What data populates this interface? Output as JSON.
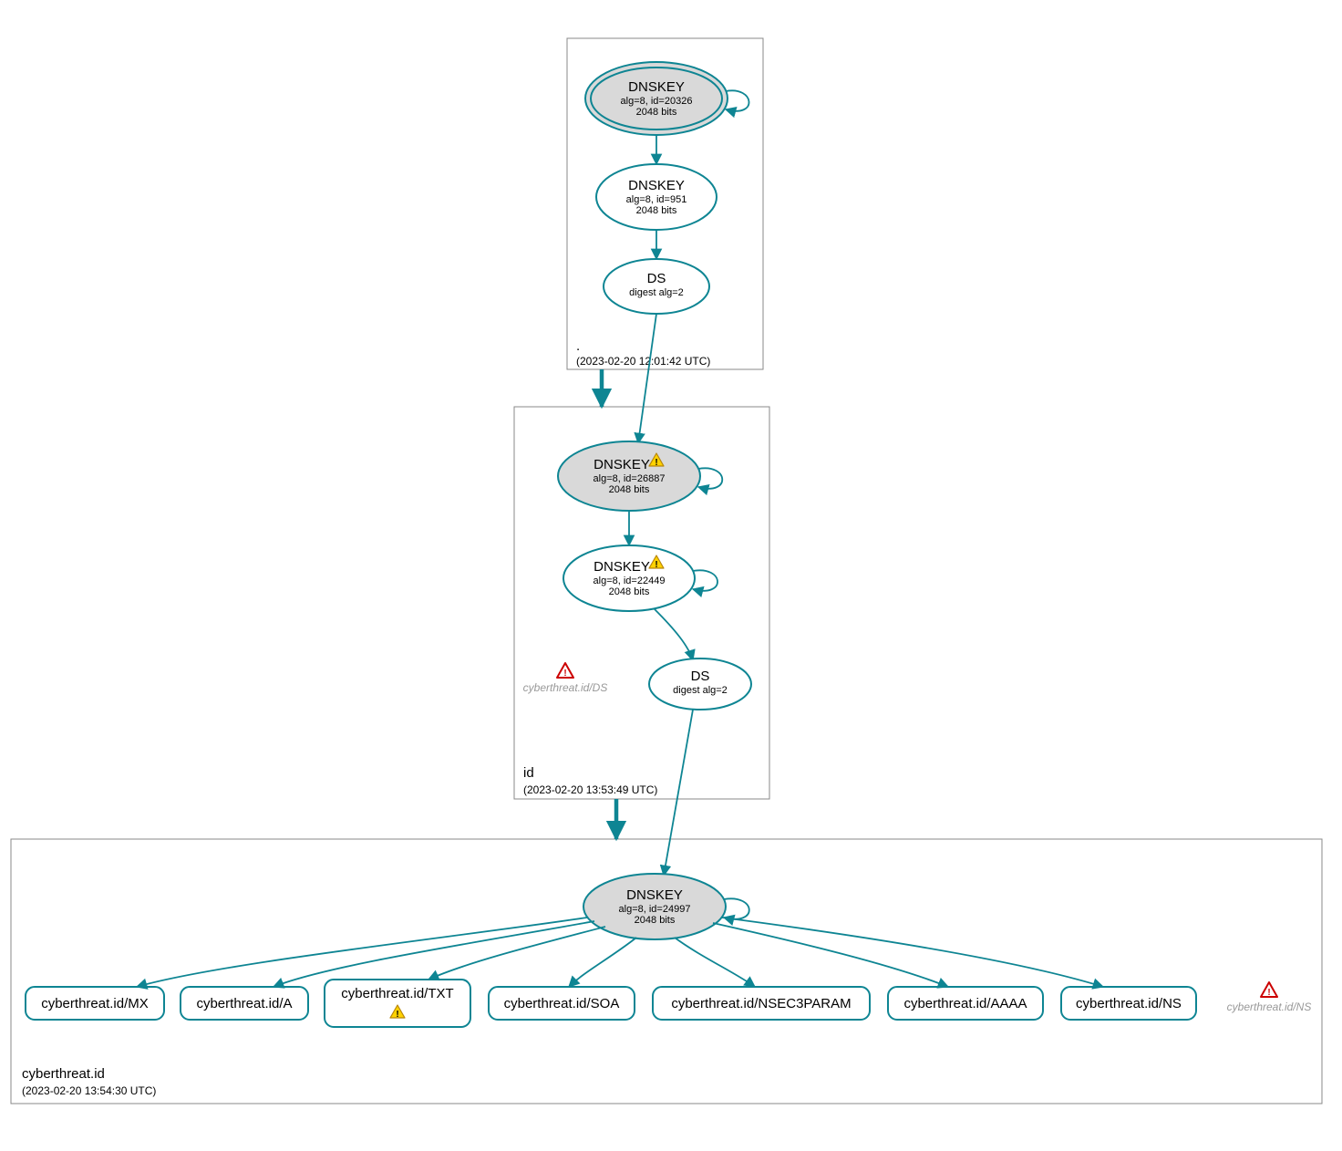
{
  "zones": {
    "root": {
      "name": ".",
      "timestamp": "(2023-02-20 12:01:42 UTC)"
    },
    "tld": {
      "name": "id",
      "timestamp": "(2023-02-20 13:53:49 UTC)"
    },
    "domain": {
      "name": "cyberthreat.id",
      "timestamp": "(2023-02-20 13:54:30 UTC)"
    }
  },
  "nodes": {
    "root_ksk": {
      "title": "DNSKEY",
      "line1": "alg=8, id=20326",
      "line2": "2048 bits"
    },
    "root_zsk": {
      "title": "DNSKEY",
      "line1": "alg=8, id=951",
      "line2": "2048 bits"
    },
    "root_ds": {
      "title": "DS",
      "line1": "digest alg=2",
      "line2": ""
    },
    "tld_ksk": {
      "title": "DNSKEY",
      "line1": "alg=8, id=26887",
      "line2": "2048 bits"
    },
    "tld_zsk": {
      "title": "DNSKEY",
      "line1": "alg=8, id=22449",
      "line2": "2048 bits"
    },
    "tld_ds": {
      "title": "DS",
      "line1": "digest alg=2",
      "line2": ""
    },
    "dom_ksk": {
      "title": "DNSKEY",
      "line1": "alg=8, id=24997",
      "line2": "2048 bits"
    }
  },
  "missing": {
    "tld_ds": "cyberthreat.id/DS",
    "dom_ns": "cyberthreat.id/NS"
  },
  "rrsets": {
    "mx": "cyberthreat.id/MX",
    "a": "cyberthreat.id/A",
    "txt": "cyberthreat.id/TXT",
    "soa": "cyberthreat.id/SOA",
    "nsec3": "cyberthreat.id/NSEC3PARAM",
    "aaaa": "cyberthreat.id/AAAA",
    "ns": "cyberthreat.id/NS"
  }
}
